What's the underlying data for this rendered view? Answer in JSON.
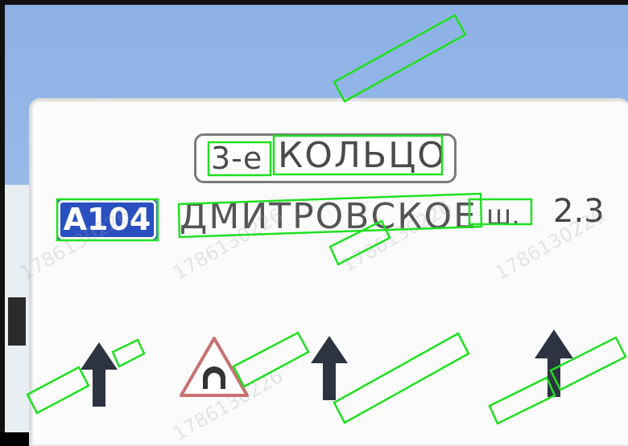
{
  "image": {
    "sign": {
      "top_panel": {
        "prefix": "3-е",
        "name": "КОЛЬЦО"
      },
      "route_shield": "A104",
      "destination": "ДМИТРОВСКОЕ",
      "suffix": "ш.",
      "distance": "2.3"
    },
    "watermark": "1786130226",
    "colors": {
      "sky": "#97b9e8",
      "sign_background": "#fbfbfb",
      "route_shield": "#2a4fc0",
      "text": "#4a4a4a",
      "annotation_box": "#1fe01f",
      "tunnel_warning": "#c87070"
    },
    "icons": [
      "up-arrow-icon",
      "up-arrow-icon",
      "up-arrow-icon",
      "tunnel-warning-icon"
    ]
  }
}
